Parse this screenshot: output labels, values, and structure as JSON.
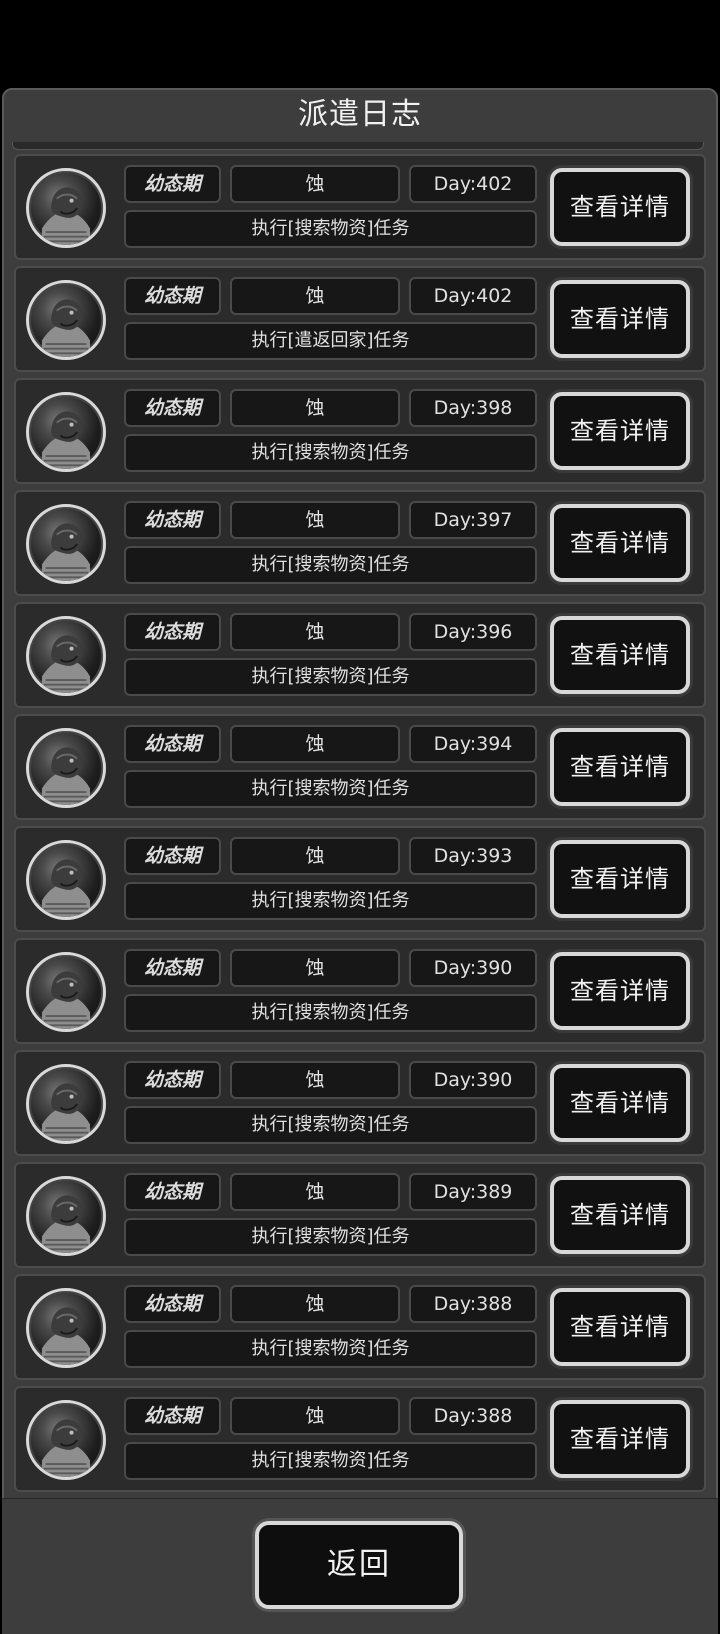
{
  "title": "派遣日志",
  "detail_label": "查看详情",
  "back_label": "返回",
  "rows": [
    {
      "stage": "幼态期",
      "name": "蚀",
      "day": "Day:402",
      "task": "执行[搜索物资]任务"
    },
    {
      "stage": "幼态期",
      "name": "蚀",
      "day": "Day:402",
      "task": "执行[遣返回家]任务"
    },
    {
      "stage": "幼态期",
      "name": "蚀",
      "day": "Day:398",
      "task": "执行[搜索物资]任务"
    },
    {
      "stage": "幼态期",
      "name": "蚀",
      "day": "Day:397",
      "task": "执行[搜索物资]任务"
    },
    {
      "stage": "幼态期",
      "name": "蚀",
      "day": "Day:396",
      "task": "执行[搜索物资]任务"
    },
    {
      "stage": "幼态期",
      "name": "蚀",
      "day": "Day:394",
      "task": "执行[搜索物资]任务"
    },
    {
      "stage": "幼态期",
      "name": "蚀",
      "day": "Day:393",
      "task": "执行[搜索物资]任务"
    },
    {
      "stage": "幼态期",
      "name": "蚀",
      "day": "Day:390",
      "task": "执行[搜索物资]任务"
    },
    {
      "stage": "幼态期",
      "name": "蚀",
      "day": "Day:390",
      "task": "执行[搜索物资]任务"
    },
    {
      "stage": "幼态期",
      "name": "蚀",
      "day": "Day:389",
      "task": "执行[搜索物资]任务"
    },
    {
      "stage": "幼态期",
      "name": "蚀",
      "day": "Day:388",
      "task": "执行[搜索物资]任务"
    },
    {
      "stage": "幼态期",
      "name": "蚀",
      "day": "Day:388",
      "task": "执行[搜索物资]任务"
    }
  ]
}
